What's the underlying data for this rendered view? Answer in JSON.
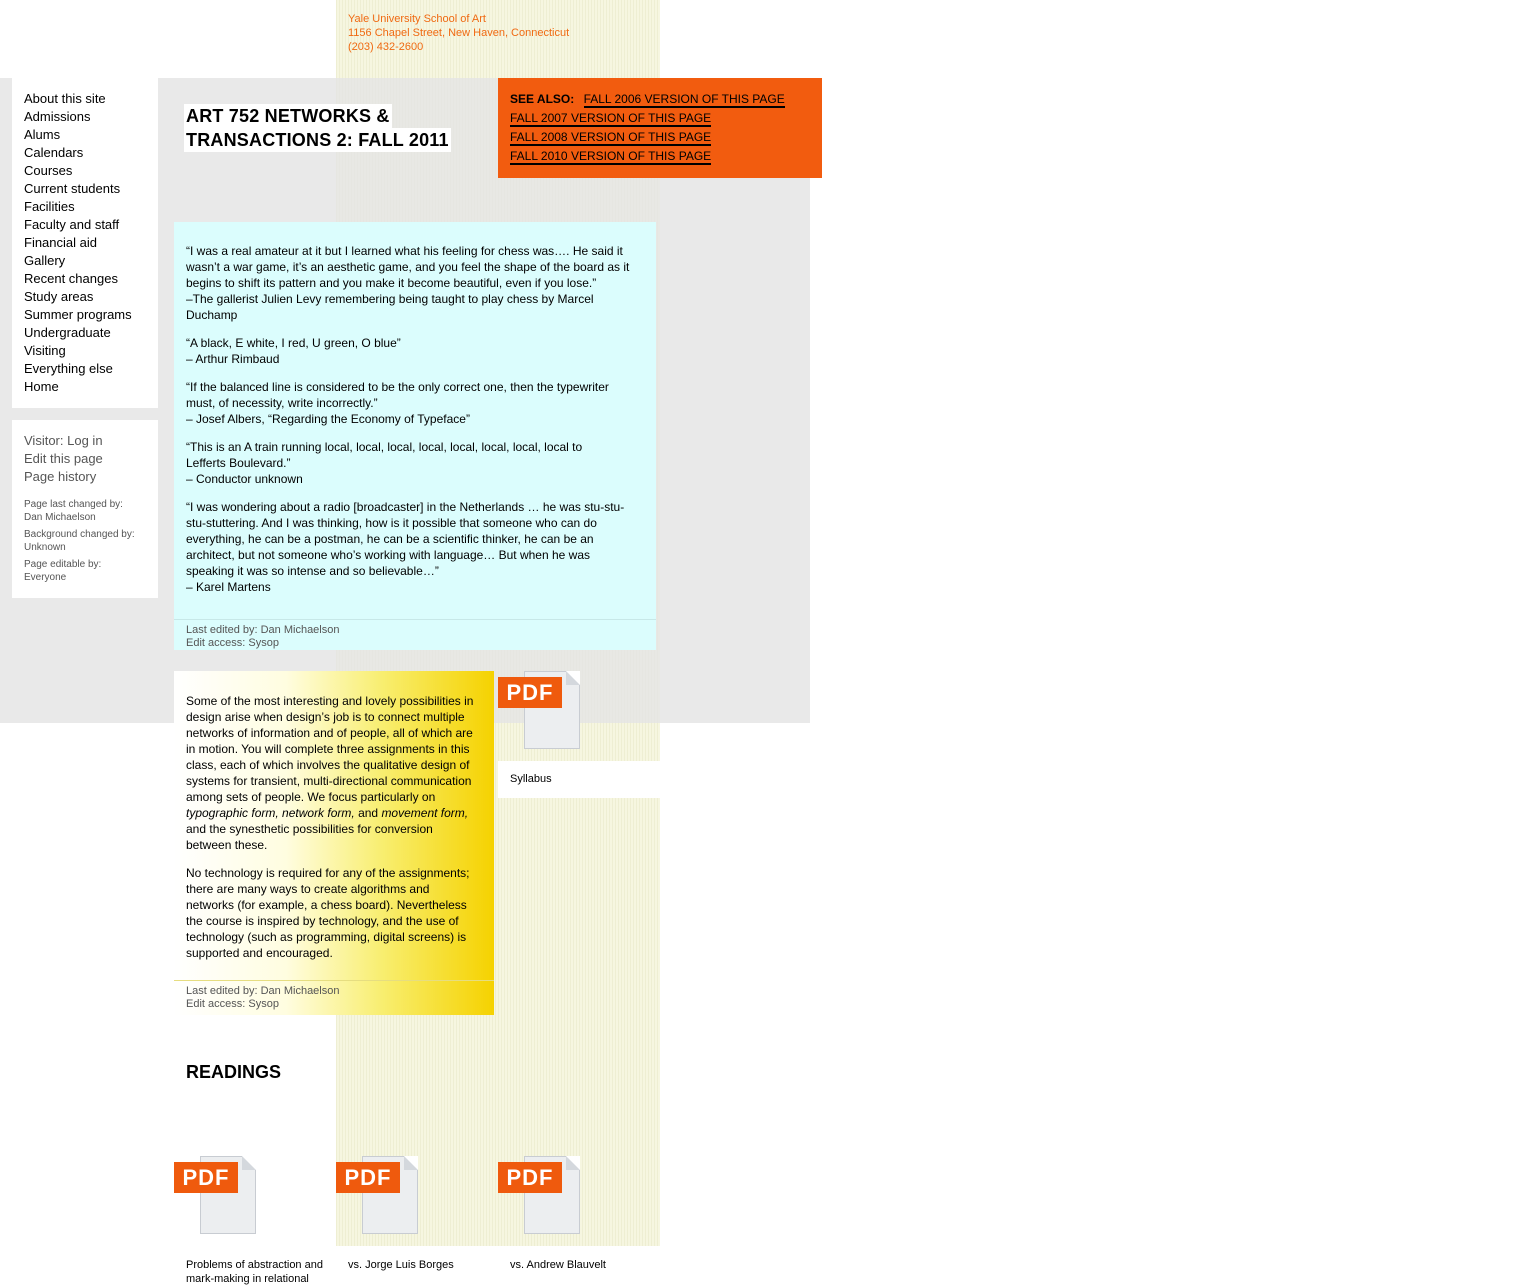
{
  "header": {
    "address_lines": [
      "Yale University School of Art",
      "1156 Chapel Street, New Haven, Connecticut",
      "(203) 432-2600"
    ]
  },
  "sidebar": {
    "nav_items": [
      "About this site",
      "Admissions",
      "Alums",
      "Calendars",
      "Courses",
      "Current students",
      "Facilities",
      "Faculty and staff",
      "Financial aid",
      "Gallery",
      "Recent changes",
      "Study areas",
      "Summer programs",
      "Undergraduate",
      "Visiting",
      "Everything else",
      "Home"
    ],
    "visitor": {
      "visitor_prefix": "Visitor:",
      "login_label": "Log in",
      "edit_page": "Edit this page",
      "page_history": "Page history"
    },
    "meta": {
      "last_changed_label": "Page last changed by:",
      "last_changed_value": "Dan Michaelson",
      "background_label": "Background changed by:",
      "background_value": "Unknown",
      "editable_label": "Page editable by:",
      "editable_value": "Everyone"
    }
  },
  "page": {
    "title_line1": "ART 752 NETWORKS &",
    "title_line2": "TRANSACTIONS 2: FALL 2011"
  },
  "see_also": {
    "label": "SEE ALSO:",
    "links": [
      "Fall 2006 version of this page",
      "Fall 2007 version of this page",
      "Fall 2008 version of this page",
      "Fall 2010 version of this page"
    ]
  },
  "quotes": {
    "q1": [
      "“I was a real amateur at it but I learned what his feeling for chess was…. He said it",
      "wasn’t a war game, it’s an aesthetic game, and you feel the shape of the board as it",
      "begins to shift its pattern and you make it become beautiful, even if you lose.”",
      "–The gallerist Julien Levy remembering being taught to play chess by Marcel",
      "Duchamp"
    ],
    "q2": [
      "“A black, E white, I red, U green, O blue”",
      "– Arthur Rimbaud"
    ],
    "q3": [
      "“If the balanced line is considered to be the only correct one, then the typewriter",
      "must, of necessity, write incorrectly.”",
      "– Josef Albers, “Regarding the Economy of Typeface”"
    ],
    "q4": [
      "“This is an A train running local, local, local, local, local, local, local, local to",
      "Lefferts Boulevard.”",
      "– Conductor unknown"
    ],
    "q5": [
      "“I was wondering about a radio [broadcaster] in the Netherlands … he was stu-stu-",
      "stu-stuttering. And I was thinking, how is it possible that someone who can do",
      "everything, he can be a postman, he can be a scientific thinker, he can be an",
      "architect, but not someone who’s working with language… But when he was",
      "speaking it was so intense and so believable…”",
      "– Karel Martens"
    ],
    "last_edited": "Last edited by: Dan Michaelson",
    "edit_access": "Edit access: Sysop"
  },
  "intro": {
    "p1_lines": [
      "Some of the most interesting and lovely possibilities in",
      "design arise when design’s job is to connect multiple",
      "networks of information and of people, all of which are",
      "in motion. You will complete three assignments in this",
      "class, each of which involves the qualitative design of",
      "systems for transient, multi-directional communication",
      "among sets of people. We focus particularly on"
    ],
    "p1_italic_1": "typographic form, network form,",
    "p1_and": " and ",
    "p1_italic_2": "movement form,",
    "p1_tail_lines": [
      "and the synesthetic possibilities for conversion",
      "between these."
    ],
    "p2_lines": [
      "No technology is required for any of the assignments;",
      "there are many ways to create algorithms and",
      "networks (for example, a chess board). Nevertheless",
      "the course is inspired by technology, and the use of",
      "technology (such as programming, digital screens) is",
      "supported and encouraged."
    ],
    "last_edited": "Last edited by: Dan Michaelson",
    "edit_access": "Edit access: Sysop"
  },
  "pdf_badge": "PDF",
  "syllabus_label": "Syllabus",
  "readings": {
    "title": "READINGS",
    "items": [
      "Problems of abstraction and mark-making in relational",
      "vs. Jorge Luis Borges",
      "vs. Andrew Blauvelt"
    ]
  },
  "colors": {
    "accent_orange": "#f25c0f",
    "quote_bg": "#dbfdfd",
    "intro_gradient_end": "#f5d200",
    "address_text": "#f06a12"
  },
  "icons": [
    "pdf-icon"
  ]
}
